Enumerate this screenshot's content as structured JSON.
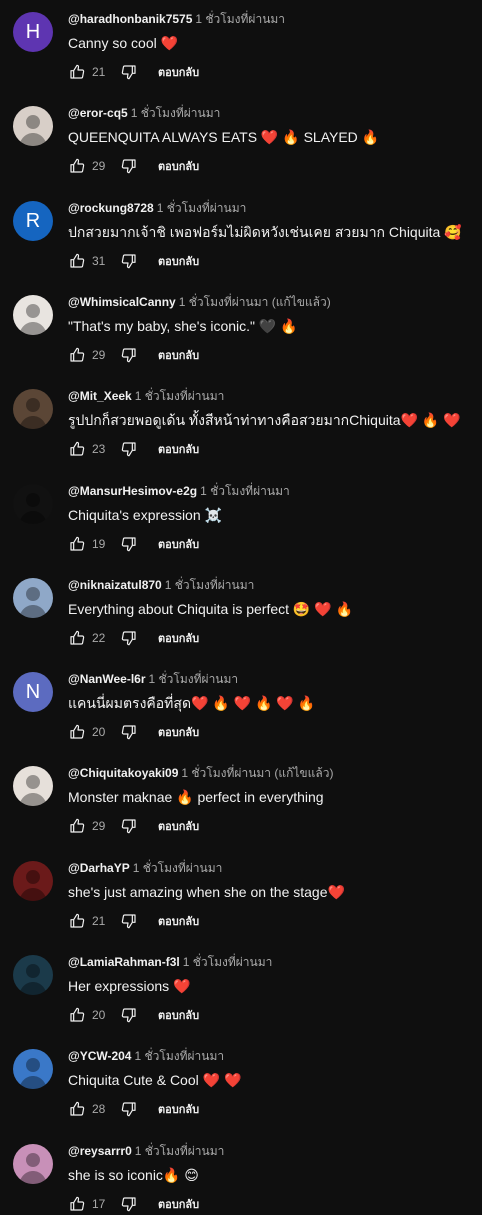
{
  "actions": {
    "reply_label": "ตอบกลับ"
  },
  "icons": {
    "like": "thumb-up-icon",
    "dislike": "thumb-down-icon"
  },
  "comments": [
    {
      "author": "@haradhonbanik7575",
      "time": "1 ชั่วโมงที่ผ่านมา",
      "text": "Canny so cool ❤️",
      "likes": "21",
      "avatar_letter": "H",
      "avatar_color": "#5e35b1"
    },
    {
      "author": "@eror-cq5",
      "time": "1 ชั่วโมงที่ผ่านมา",
      "text": "QUEENQUITA ALWAYS EATS ❤️ 🔥 SLAYED 🔥",
      "likes": "29",
      "avatar_letter": "",
      "avatar_color": "#d8cfc8"
    },
    {
      "author": "@rockung8728",
      "time": "1 ชั่วโมงที่ผ่านมา",
      "text": "ปกสวยมากเจ้าชิ  เพอฟอร์มไม่ผิดหวังเช่นเคย  สวยมาก Chiquita  🥰",
      "likes": "31",
      "avatar_letter": "R",
      "avatar_color": "#1565c0"
    },
    {
      "author": "@WhimsicalCanny",
      "time": "1 ชั่วโมงที่ผ่านมา (แก้ไขแล้ว)",
      "text": "\"That's my baby, she's iconic.\" 🖤 🔥",
      "likes": "29",
      "avatar_letter": "",
      "avatar_color": "#e8e4e0"
    },
    {
      "author": "@Mit_Xeek",
      "time": "1 ชั่วโมงที่ผ่านมา",
      "text": "รูปปกก็สวยพอดูเด้น ทั้งสีหน้าท่าทางคือสวยมากChiquita❤️ 🔥 ❤️",
      "likes": "23",
      "avatar_letter": "",
      "avatar_color": "#5b4636"
    },
    {
      "author": "@MansurHesimov-e2g",
      "time": "1 ชั่วโมงที่ผ่านมา",
      "text": "Chiquita's expression ☠️",
      "likes": "19",
      "avatar_letter": "",
      "avatar_color": "#111111"
    },
    {
      "author": "@niknaizatul870",
      "time": "1 ชั่วโมงที่ผ่านมา",
      "text": "Everything about Chiquita is perfect 🤩  ❤️ 🔥",
      "likes": "22",
      "avatar_letter": "",
      "avatar_color": "#8fa8c8"
    },
    {
      "author": "@NanWee-l6r",
      "time": "1 ชั่วโมงที่ผ่านมา",
      "text": "แคนนี่ผมตรงคือที่สุด❤️ 🔥 ❤️ 🔥 ❤️ 🔥",
      "likes": "20",
      "avatar_letter": "N",
      "avatar_color": "#5c6bc0"
    },
    {
      "author": "@Chiquitakoyaki09",
      "time": "1 ชั่วโมงที่ผ่านมา (แก้ไขแล้ว)",
      "text": "Monster maknae 🔥 perfect in everything",
      "likes": "29",
      "avatar_letter": "",
      "avatar_color": "#e6e0da"
    },
    {
      "author": "@DarhaYP",
      "time": "1 ชั่วโมงที่ผ่านมา",
      "text": "she's just amazing when she on the stage❤️",
      "likes": "21",
      "avatar_letter": "",
      "avatar_color": "#6b1a1a"
    },
    {
      "author": "@LamiaRahman-f3l",
      "time": "1 ชั่วโมงที่ผ่านมา",
      "text": "Her expressions ❤️",
      "likes": "20",
      "avatar_letter": "",
      "avatar_color": "#1b3a4a"
    },
    {
      "author": "@YCW-204",
      "time": "1 ชั่วโมงที่ผ่านมา",
      "text": "Chiquita Cute & Cool ❤️ ❤️",
      "likes": "28",
      "avatar_letter": "",
      "avatar_color": "#3a78c8"
    },
    {
      "author": "@reysarrr0",
      "time": "1 ชั่วโมงที่ผ่านมา",
      "text": "she is so iconic🔥 😊",
      "likes": "17",
      "avatar_letter": "",
      "avatar_color": "#c890b8"
    }
  ]
}
